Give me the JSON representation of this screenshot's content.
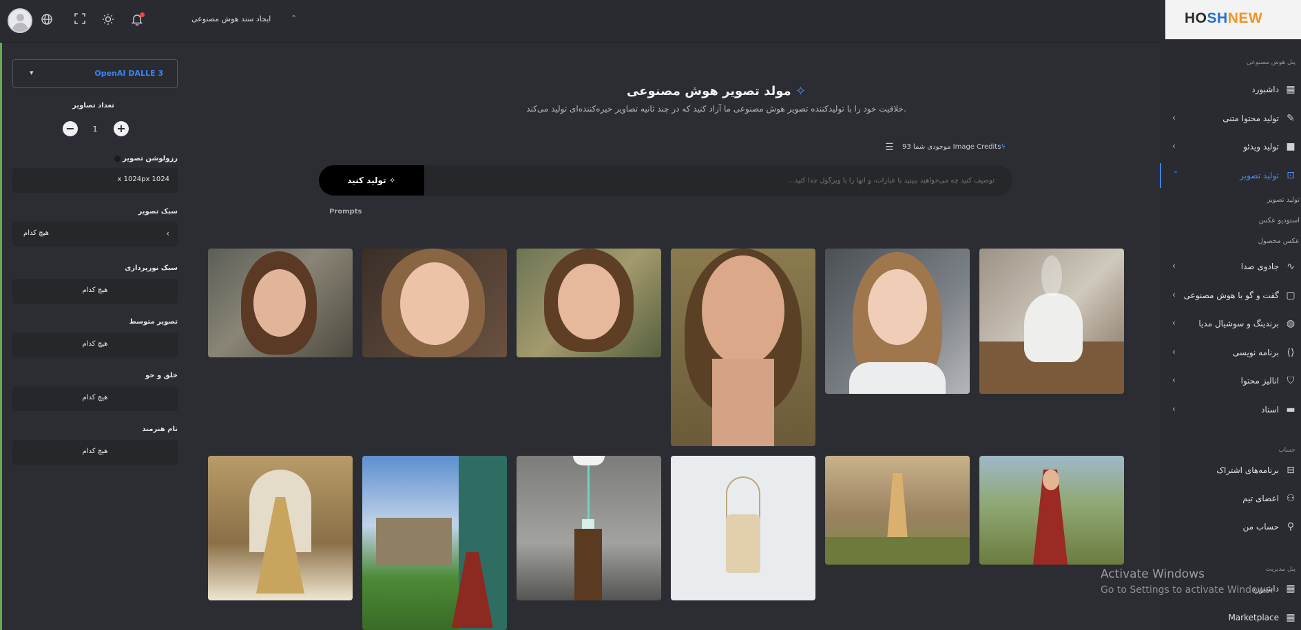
{
  "topbar": {
    "title": "ایجاد سند هوش مصنوعی",
    "icons": [
      "avatar",
      "globe-icon",
      "fullscreen-icon",
      "sun-icon",
      "bell-icon"
    ]
  },
  "logo": {
    "part1": "HO",
    "part2": "SH",
    "part3": "NEW"
  },
  "sidebar": {
    "section_main": "پنل هوش مصنوعی",
    "items": [
      {
        "label": "داشبورد",
        "icon": "dashboard-icon"
      },
      {
        "label": "تولید محتوا متنی",
        "icon": "pencil-icon"
      },
      {
        "label": "تولید ویدئو",
        "icon": "video-icon"
      },
      {
        "label": "تولید تصویر",
        "icon": "image-icon",
        "active": true
      },
      {
        "label": "جادوی صدا",
        "icon": "waveform-icon"
      },
      {
        "label": "گفت و گو با هوش مصنوعی",
        "icon": "chat-icon"
      },
      {
        "label": "برندینگ و سوشیال مدیا",
        "icon": "palette-icon"
      },
      {
        "label": "برنامه نویسی",
        "icon": "code-icon"
      },
      {
        "label": "انالیز محتوا",
        "icon": "shield-icon"
      },
      {
        "label": "اسناد",
        "icon": "folder-icon"
      }
    ],
    "subitems": [
      "تولید تصویر",
      "استودیو عکس",
      "عکس محصول"
    ],
    "section_account": "حساب",
    "account_items": [
      {
        "label": "برنامه‌های اشتراک",
        "icon": "subscription-icon"
      },
      {
        "label": "اعضای تیم",
        "icon": "team-icon"
      },
      {
        "label": "حساب من",
        "icon": "user-icon"
      }
    ],
    "section_admin": "پنل مدیریت",
    "admin_items": [
      {
        "label": "داشبورد",
        "icon": "dashboard-icon"
      },
      {
        "label": "Marketplace",
        "icon": "grid-icon"
      }
    ]
  },
  "watermark": {
    "line1": "Activate Windows",
    "line2": "Go to Settings to activate Windows."
  },
  "settings": {
    "model": "OpenAI DALLE 3",
    "count_label": "تعداد تصاویر",
    "count_value": "1",
    "resolution_label": "رزولوشن تصویر",
    "resolution_value": "1024 x 1024px",
    "style_label": "سبک تصویر",
    "style_value": "هیچ کدام",
    "lighting_label": "سبک نورپردازی",
    "lighting_value": "هیچ کدام",
    "medium_label": "تصویر متوسط",
    "medium_value": "هیچ کدام",
    "mood_label": "خلق و خو",
    "mood_value": "هیچ کدام",
    "artist_label": "نام هنرمند",
    "artist_value": "هیچ کدام"
  },
  "main": {
    "title": "مولد تصویر هوش مصنوعی",
    "subtitle": "خلاقیت خود را با تولیدکننده تصویر هوش مصنوعی ما آزاد کنید که در چند ثانیه تصاویر خیره‌کننده‌ای تولید می‌کند.",
    "credits": "موجودی شما 93 Image Credits",
    "generate_button": "تولید کنید",
    "prompt_placeholder": "توصیف کنید چه می‌خواهید ببینید با عبارات، و آنها را با ویرگول جدا کنید...",
    "prompts_tab": "Prompts"
  },
  "colors": {
    "accent": "#3b82f6",
    "background": "#2c2d32",
    "panel": "#26272b"
  }
}
